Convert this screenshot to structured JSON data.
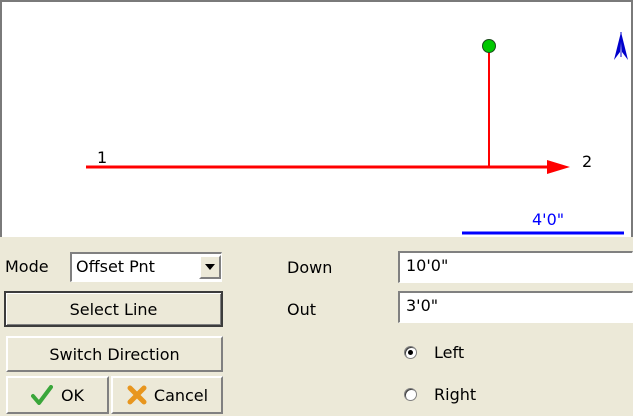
{
  "canvas": {
    "point_start_label": "1",
    "point_end_label": "2",
    "scale_label": "4'0\"",
    "colors": {
      "line": "#ff0000",
      "scale": "#0000ff",
      "point": "#00c800",
      "north": "#0000cc"
    },
    "north_icon": "north-arrow-icon"
  },
  "controls": {
    "mode_label": "Mode",
    "mode_value": "Offset Pnt",
    "select_line_label": "Select Line",
    "switch_direction_label": "Switch Direction",
    "ok_label": "OK",
    "cancel_label": "Cancel",
    "down_label": "Down",
    "down_value": "10'0\"",
    "out_label": "Out",
    "out_value": "3'0\"",
    "left_label": "Left",
    "right_label": "Right",
    "selected_side": "left"
  }
}
